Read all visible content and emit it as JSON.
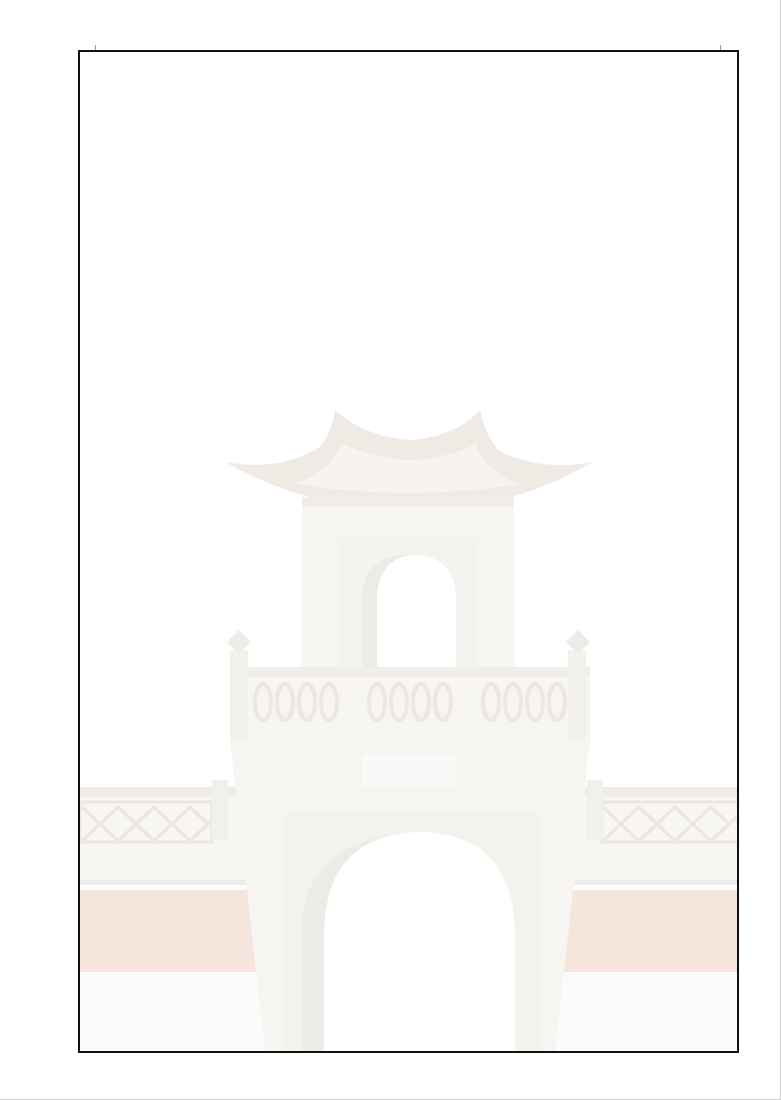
{
  "document": {
    "title": "",
    "body_text": ""
  },
  "illustration": {
    "subject": "temple-gate-illustration",
    "colors": {
      "roof": "#efebe4",
      "tower": "#f7f5f1",
      "tower_shade": "#ecebe6",
      "band": "#f5e5dc",
      "ground": "#fcfbfb",
      "frame": "#111111"
    }
  }
}
